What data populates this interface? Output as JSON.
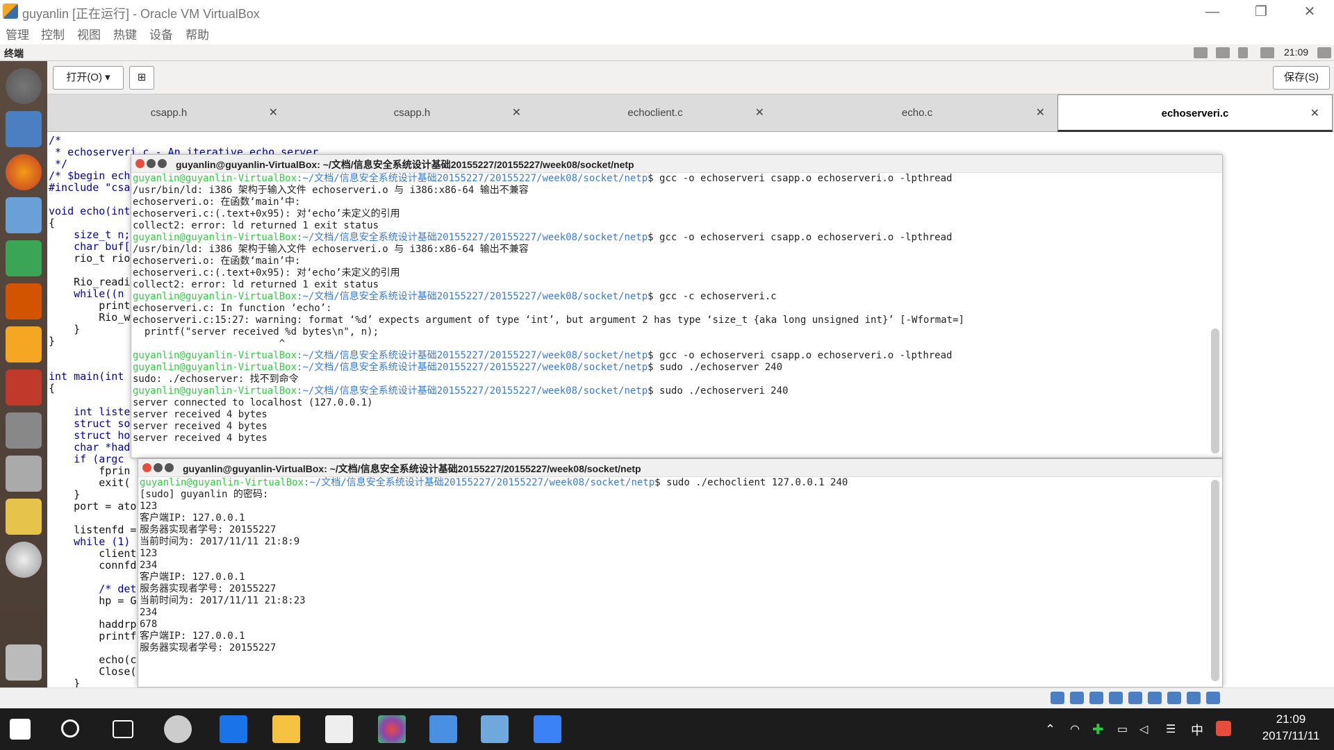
{
  "window": {
    "title": "guyanlin [正在运行] - Oracle VM VirtualBox"
  },
  "menu": [
    "管理",
    "控制",
    "视图",
    "热键",
    "设备",
    "帮助"
  ],
  "panel": {
    "app_label": "终端",
    "clock": "21:09"
  },
  "toolbar": {
    "open_label": "打开(O)",
    "save_label": "保存(S)"
  },
  "tabs": [
    "csapp.h",
    "csapp.h",
    "echoclient.c",
    "echo.c",
    "echoserveri.c"
  ],
  "editor_lines": [
    "/*",
    " * echoserveri.c - An iterative echo server",
    " */",
    "/* $begin ech",
    "#include \"csa",
    "",
    "void echo(int",
    "{",
    "    size_t n;",
    "    char buf[",
    "    rio_t rio",
    "",
    "    Rio_readi",
    "    while((n",
    "        print",
    "        Rio_w",
    "    }",
    "}",
    "",
    "",
    "int main(int",
    "{",
    "",
    "    int liste",
    "    struct so",
    "    struct ho",
    "    char *had",
    "    if (argc",
    "        fprin",
    "        exit(",
    "    }",
    "    port = ato",
    "",
    "    listenfd =",
    "    while (1)",
    "        client",
    "        connfd",
    "",
    "        /* det",
    "        hp = G",
    "",
    "        haddrp",
    "        printf",
    "",
    "        echo(c",
    "        Close(",
    "    }"
  ],
  "terminal1": {
    "title": "guyanlin@guyanlin-VirtualBox: ~/文档/信息安全系统设计基础20155227/20155227/week08/socket/netp",
    "prompt": "guyanlin@guyanlin-VirtualBox",
    "path": ":~/文档/信息安全系统设计基础20155227/20155227/week08/socket/netp",
    "lines": [
      {
        "p": true,
        "t": "$ gcc -o echoserveri csapp.o echoserveri.o -lpthread"
      },
      {
        "p": false,
        "t": "/usr/bin/ld: i386 架构于输入文件 echoserveri.o 与 i386:x86-64 输出不兼容"
      },
      {
        "p": false,
        "t": "echoserveri.o: 在函数‘main’中:"
      },
      {
        "p": false,
        "t": "echoserveri.c:(.text+0x95): 对‘echo’未定义的引用"
      },
      {
        "p": false,
        "t": "collect2: error: ld returned 1 exit status"
      },
      {
        "p": true,
        "t": "$ gcc -o echoserveri csapp.o echoserveri.o -lpthread"
      },
      {
        "p": false,
        "t": "/usr/bin/ld: i386 架构于输入文件 echoserveri.o 与 i386:x86-64 输出不兼容"
      },
      {
        "p": false,
        "t": "echoserveri.o: 在函数‘main’中:"
      },
      {
        "p": false,
        "t": "echoserveri.c:(.text+0x95): 对‘echo’未定义的引用"
      },
      {
        "p": false,
        "t": "collect2: error: ld returned 1 exit status"
      },
      {
        "p": true,
        "t": "$ gcc -c echoserveri.c"
      },
      {
        "p": false,
        "t": "echoserveri.c: In function ‘echo’:"
      },
      {
        "p": false,
        "t": "echoserveri.c:15:27: warning: format ‘%d’ expects argument of type ‘int’, but argument 2 has type ‘size_t {aka long unsigned int}’ [-Wformat=]"
      },
      {
        "p": false,
        "t": "  printf(\"server received %d bytes\\n\", n);"
      },
      {
        "p": false,
        "t": "                         ^"
      },
      {
        "p": true,
        "t": "$ gcc -o echoserveri csapp.o echoserveri.o -lpthread"
      },
      {
        "p": true,
        "t": "$ sudo ./echoserver 240"
      },
      {
        "p": false,
        "t": "sudo: ./echoserver: 找不到命令"
      },
      {
        "p": true,
        "t": "$ sudo ./echoserveri 240"
      },
      {
        "p": false,
        "t": "server connected to localhost (127.0.0.1)"
      },
      {
        "p": false,
        "t": "server received 4 bytes"
      },
      {
        "p": false,
        "t": "server received 4 bytes"
      },
      {
        "p": false,
        "t": "server received 4 bytes"
      }
    ]
  },
  "terminal2": {
    "title": "guyanlin@guyanlin-VirtualBox: ~/文档/信息安全系统设计基础20155227/20155227/week08/socket/netp",
    "prompt": "guyanlin@guyanlin-VirtualBox",
    "path": ":~/文档/信息安全系统设计基础20155227/20155227/week08/socket/netp",
    "lines": [
      {
        "p": true,
        "t": "$ sudo ./echoclient 127.0.0.1 240"
      },
      {
        "p": false,
        "t": "[sudo] guyanlin 的密码:"
      },
      {
        "p": false,
        "t": "123"
      },
      {
        "p": false,
        "t": "客户端IP: 127.0.0.1"
      },
      {
        "p": false,
        "t": "服务器实现者学号: 20155227"
      },
      {
        "p": false,
        "t": "当前时间为: 2017/11/11 21:8:9"
      },
      {
        "p": false,
        "t": "123"
      },
      {
        "p": false,
        "t": "234"
      },
      {
        "p": false,
        "t": "客户端IP: 127.0.0.1"
      },
      {
        "p": false,
        "t": "服务器实现者学号: 20155227"
      },
      {
        "p": false,
        "t": "当前时间为: 2017/11/11 21:8:23"
      },
      {
        "p": false,
        "t": "234"
      },
      {
        "p": false,
        "t": "678"
      },
      {
        "p": false,
        "t": "客户端IP: 127.0.0.1"
      },
      {
        "p": false,
        "t": "服务器实现者学号: 20155227"
      }
    ]
  },
  "taskbar": {
    "time": "21:09",
    "date": "2017/11/11",
    "ime": "中"
  },
  "colors": {
    "prompt": "#2ecc40",
    "path": "#3a7ad9",
    "keyword": "#0000aa"
  }
}
